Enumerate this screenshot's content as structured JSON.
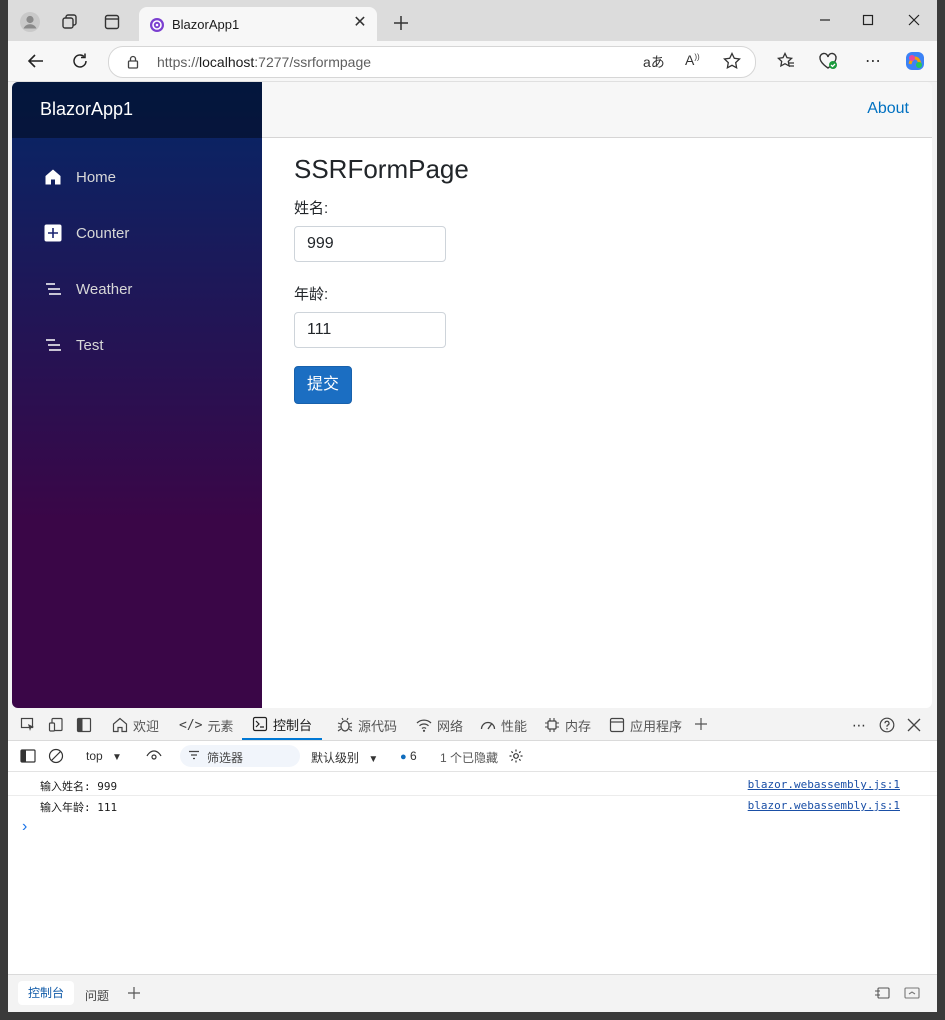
{
  "browser": {
    "tab_title": "BlazorApp1",
    "url_prefix": "https://",
    "url_host": "localhost",
    "url_path": ":7277/ssrformpage"
  },
  "app": {
    "brand": "BlazorApp1",
    "about_link": "About",
    "nav": [
      {
        "label": "Home",
        "icon": "home-icon"
      },
      {
        "label": "Counter",
        "icon": "plus-square-icon"
      },
      {
        "label": "Weather",
        "icon": "list-icon"
      },
      {
        "label": "Test",
        "icon": "list-icon"
      }
    ],
    "page_title": "SSRFormPage",
    "form": {
      "name_label": "姓名:",
      "name_value": "999",
      "age_label": "年龄:",
      "age_value": "111",
      "submit_label": "提交"
    }
  },
  "devtools": {
    "tabs": [
      {
        "label": "欢迎",
        "icon": "home-icon"
      },
      {
        "label": "元素",
        "icon": "code-icon"
      },
      {
        "label": "控制台",
        "icon": "console-icon"
      },
      {
        "label": "源代码",
        "icon": "bug-icon"
      },
      {
        "label": "网络",
        "icon": "wifi-icon"
      },
      {
        "label": "性能",
        "icon": "gauge-icon"
      },
      {
        "label": "内存",
        "icon": "chip-icon"
      },
      {
        "label": "应用程序",
        "icon": "window-icon"
      }
    ],
    "active_tab": "控制台",
    "context": "top",
    "filter_placeholder": "筛选器",
    "level": "默认级别",
    "message_count": "6",
    "hidden_count": "1 个已隐藏",
    "logs": [
      {
        "message": "输入姓名: 999",
        "source": "blazor.webassembly.js:1"
      },
      {
        "message": "输入年龄: 111",
        "source": "blazor.webassembly.js:1"
      }
    ],
    "prompt": "›",
    "drawer_tabs": [
      "控制台",
      "问题"
    ]
  }
}
